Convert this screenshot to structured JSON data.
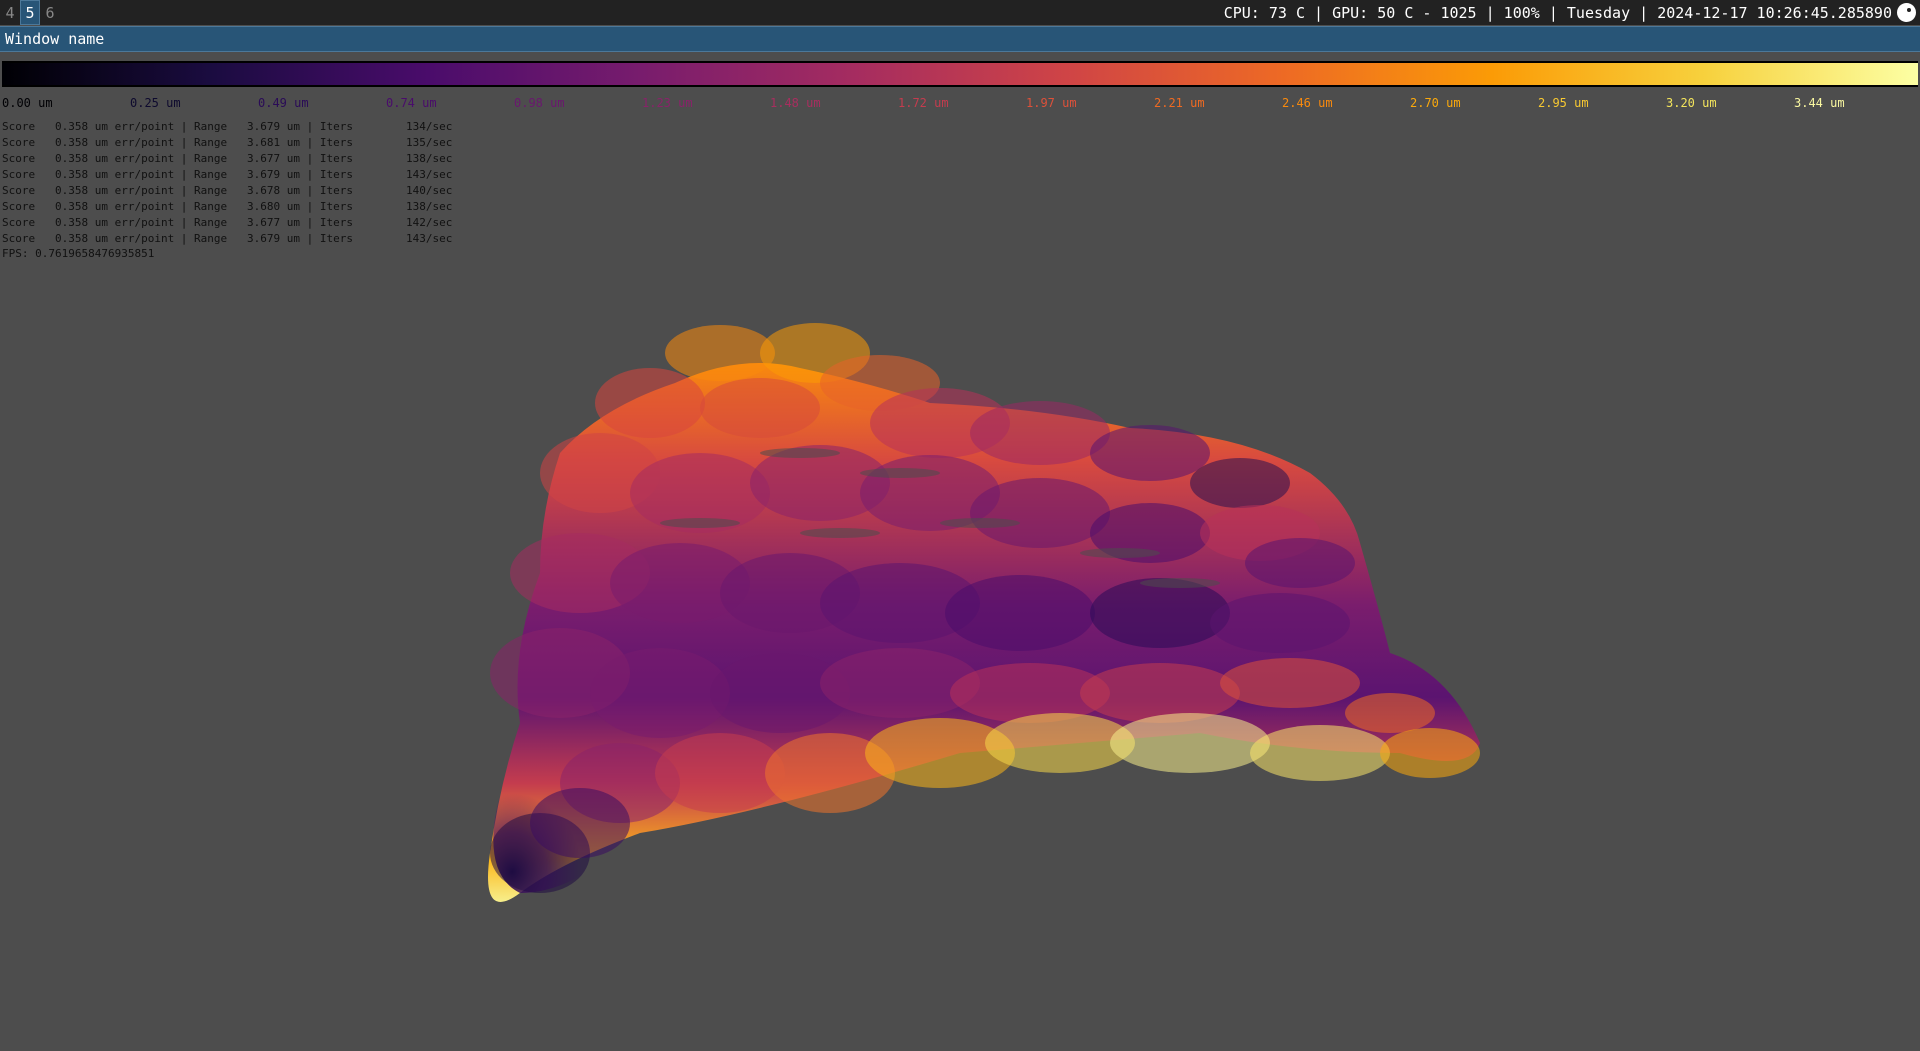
{
  "taskbar": {
    "workspaces": [
      {
        "label": "4",
        "active": false
      },
      {
        "label": "5",
        "active": true
      },
      {
        "label": "6",
        "active": false
      }
    ],
    "status_text": "CPU: 73 C | GPU: 50 C - 1025 | 100% | Tuesday | 2024-12-17 10:26:45.285890",
    "tray_icon": "steam-icon"
  },
  "window": {
    "title": "Window name"
  },
  "colorbar": {
    "colormap": "inferno",
    "stops": [
      "#000004",
      "#1b0c41",
      "#4a0c6b",
      "#781c6d",
      "#a52c60",
      "#cf4446",
      "#ed6925",
      "#fb9b06",
      "#f7d13d",
      "#fcffa4"
    ],
    "ticks": [
      {
        "label": "0.00 um",
        "color": "#000004"
      },
      {
        "label": "0.25 um",
        "color": "#0e0a2e"
      },
      {
        "label": "0.49 um",
        "color": "#2a0b57"
      },
      {
        "label": "0.74 um",
        "color": "#4a0c6b"
      },
      {
        "label": "0.98 um",
        "color": "#6a176e"
      },
      {
        "label": "1.23 um",
        "color": "#8a226a"
      },
      {
        "label": "1.48 um",
        "color": "#a82e5f"
      },
      {
        "label": "1.72 um",
        "color": "#c43c4e"
      },
      {
        "label": "1.97 um",
        "color": "#dd513a"
      },
      {
        "label": "2.21 um",
        "color": "#ef6a22"
      },
      {
        "label": "2.46 um",
        "color": "#f98a0d"
      },
      {
        "label": "2.70 um",
        "color": "#fba90c"
      },
      {
        "label": "2.95 um",
        "color": "#f8c932"
      },
      {
        "label": "3.20 um",
        "color": "#f3e45c"
      },
      {
        "label": "3.44 um",
        "color": "#f9f7a0"
      }
    ]
  },
  "log": {
    "lines": [
      "Score   0.358 um err/point | Range   3.679 um | Iters        134/sec",
      "Score   0.358 um err/point | Range   3.681 um | Iters        135/sec",
      "Score   0.358 um err/point | Range   3.677 um | Iters        138/sec",
      "Score   0.358 um err/point | Range   3.679 um | Iters        143/sec",
      "Score   0.358 um err/point | Range   3.678 um | Iters        140/sec",
      "Score   0.358 um err/point | Range   3.680 um | Iters        138/sec",
      "Score   0.358 um err/point | Range   3.677 um | Iters        142/sec",
      "Score   0.358 um err/point | Range   3.679 um | Iters        143/sec"
    ],
    "fps": "FPS: 0.7619658476935851"
  }
}
